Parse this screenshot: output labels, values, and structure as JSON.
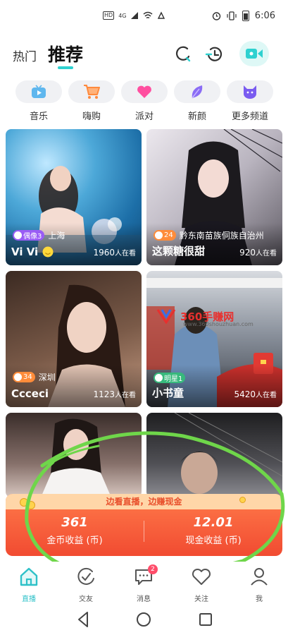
{
  "status_bar": {
    "left_badges": [
      "HD",
      "4G"
    ],
    "time": "6:06",
    "icons": [
      "sim-signal-icon",
      "wifi-icon",
      "notification-icon",
      "alarm-icon",
      "vibrate-icon",
      "battery-icon"
    ]
  },
  "top_nav": {
    "tabs": [
      {
        "label": "热门",
        "active": false
      },
      {
        "label": "推荐",
        "active": true
      }
    ],
    "icons": [
      "search-icon",
      "history-icon",
      "go-live-video-icon"
    ],
    "accent": "#2ed1d0"
  },
  "channels": [
    {
      "label": "音乐",
      "icon": "tv-icon",
      "color": "#5fb7ee"
    },
    {
      "label": "嗨购",
      "icon": "shopping-cart-icon",
      "color": "#ff8a3d"
    },
    {
      "label": "派对",
      "icon": "heart-icon",
      "color": "#ff4fa0"
    },
    {
      "label": "新颜",
      "icon": "leaf-icon",
      "color": "#8a6cf5"
    },
    {
      "label": "更多频道",
      "icon": "cat-icon",
      "color": "#7a5cf0"
    }
  ],
  "cards": [
    {
      "name": "Vi Vi",
      "viewers": "1960",
      "viewers_suffix": "人在看",
      "location": "上海",
      "badge": "偶像3",
      "badge_color": "#9a5cf5",
      "emoji": "smile-emoji-icon"
    },
    {
      "name": "这颗糖很甜",
      "viewers": "920",
      "viewers_suffix": "人在看",
      "location": "黔东南苗族侗族自治州",
      "badge": "24",
      "badge_color": "#ff8c3a"
    },
    {
      "name": "Ccceci",
      "viewers": "1123",
      "viewers_suffix": "人在看",
      "location": "深圳",
      "badge": "34",
      "badge_color": "#ff8c3a"
    },
    {
      "name": "小书童",
      "viewers": "5420",
      "viewers_suffix": "人在看",
      "location": "",
      "badge": "明星1",
      "badge_color": "#37b97c"
    },
    {
      "name": "",
      "viewers": "",
      "viewers_suffix": "",
      "location": "",
      "badge": ""
    },
    {
      "name": "",
      "viewers": "",
      "viewers_suffix": "",
      "location": "",
      "badge": ""
    }
  ],
  "watermark": {
    "text": "360手赚网",
    "sub": "www.360shouzhuan.com"
  },
  "earnings": {
    "headline": "边看直播，边赚现金",
    "coin_value": "361",
    "coin_label": "金币收益 (币)",
    "cash_value": "12.01",
    "cash_label": "现金收益 (币)"
  },
  "tabbar": [
    {
      "label": "直播",
      "icon": "home-icon",
      "active": true
    },
    {
      "label": "交友",
      "icon": "compass-icon",
      "active": false
    },
    {
      "label": "消息",
      "icon": "message-icon",
      "active": false,
      "badge": "2"
    },
    {
      "label": "关注",
      "icon": "heart-outline-icon",
      "active": false
    },
    {
      "label": "我",
      "icon": "profile-icon",
      "active": false
    }
  ]
}
